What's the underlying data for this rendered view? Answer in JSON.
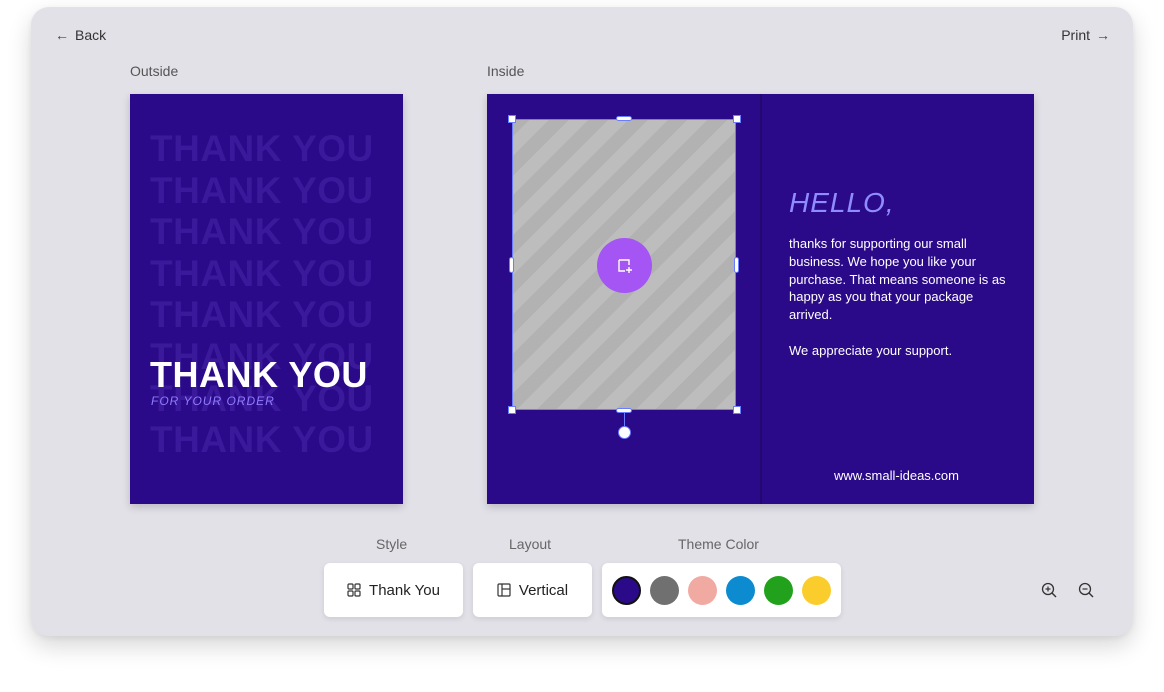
{
  "nav": {
    "back_label": "Back",
    "print_label": "Print"
  },
  "sections": {
    "outside_label": "Outside",
    "inside_label": "Inside"
  },
  "outside_card": {
    "background_color": "#2a0a88",
    "ghost_text": "THANK YOU",
    "title": "THANK YOU",
    "subtitle": "FOR YOUR ORDER"
  },
  "inside_card": {
    "greeting": "HELLO,",
    "message_paragraphs": [
      "thanks for supporting our small business. We hope you like your purchase. That means someone is as happy as you that your package arrived.",
      "We appreciate your support."
    ],
    "website": "www.small-ideas.com"
  },
  "controls": {
    "style_label": "Style",
    "style_value": "Thank You",
    "layout_label": "Layout",
    "layout_value": "Vertical",
    "theme_label": "Theme Color",
    "theme_colors": [
      {
        "name": "indigo",
        "hex": "#2a0a88",
        "selected": true
      },
      {
        "name": "gray",
        "hex": "#707070",
        "selected": false
      },
      {
        "name": "pink",
        "hex": "#f0aaa2",
        "selected": false
      },
      {
        "name": "blue",
        "hex": "#0c8bd0",
        "selected": false
      },
      {
        "name": "green",
        "hex": "#22a21c",
        "selected": false
      },
      {
        "name": "yellow",
        "hex": "#fbcd2c",
        "selected": false
      }
    ]
  },
  "icons": {
    "back": "arrow-left-icon",
    "print": "arrow-right-icon",
    "add_image": "add-image-icon",
    "style": "grid-icon",
    "layout": "layout-icon",
    "zoom_in": "zoom-in-icon",
    "zoom_out": "zoom-out-icon"
  }
}
